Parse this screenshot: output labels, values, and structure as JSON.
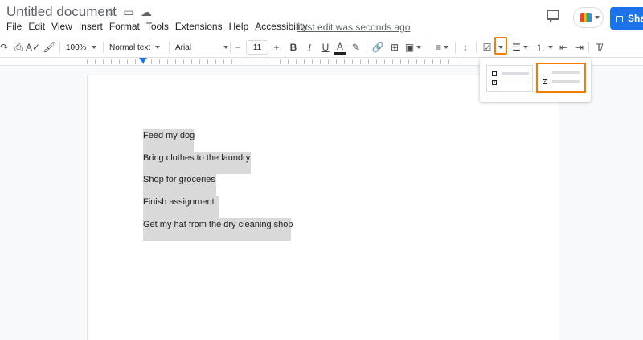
{
  "header": {
    "title": "Untitled document",
    "title_icons": [
      "star-icon",
      "move-folder-icon",
      "cloud-saved-icon"
    ],
    "last_edit": "Last edit was seconds ago",
    "share_label": "Sha"
  },
  "menu": [
    "File",
    "Edit",
    "View",
    "Insert",
    "Format",
    "Tools",
    "Extensions",
    "Help",
    "Accessibility"
  ],
  "toolbar": {
    "zoom": "100%",
    "style": "Normal text",
    "font": "Arial",
    "font_size": "11",
    "minus": "−",
    "plus": "+"
  },
  "document": {
    "lines": [
      "Feed my dog",
      "Bring clothes to the laundry",
      "Shop for groceries",
      "Finish assignment",
      "Get my hat from the dry cleaning shop"
    ]
  },
  "checklist_menu": {
    "options": [
      "checklist-strikethrough",
      "checklist-plain"
    ],
    "selected": "checklist-plain"
  },
  "colors": {
    "accent": "#f57c00",
    "share": "#1a73e8",
    "selection": "#d9d9d9"
  }
}
